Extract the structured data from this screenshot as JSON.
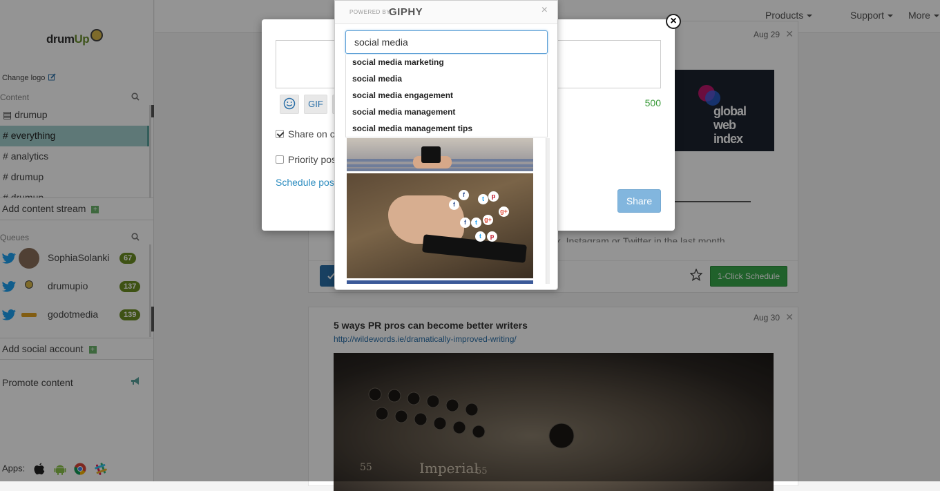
{
  "sidebar": {
    "logo_text": "drumUp",
    "logo_text_a": "drum",
    "logo_text_b": "Up",
    "change_logo": "Change logo",
    "content_header": "Content",
    "streams": [
      {
        "prefix": "▤",
        "label": "drumup"
      },
      {
        "prefix": "#",
        "label": "everything"
      },
      {
        "prefix": "#",
        "label": "analytics"
      },
      {
        "prefix": "#",
        "label": "drumup"
      },
      {
        "prefix": "#",
        "label": "drumup"
      }
    ],
    "add_stream": "Add content stream",
    "queues_header": "Queues",
    "queues": [
      {
        "name": "SophiaSolanki",
        "count": "67"
      },
      {
        "name": "drumupio",
        "count": "137"
      },
      {
        "name": "godotmedia",
        "count": "139"
      }
    ],
    "add_social": "Add social account",
    "promote": "Promote content",
    "apps_label": "Apps:"
  },
  "topnav": {
    "products": "Products",
    "support": "Support",
    "more": "More"
  },
  "feed": {
    "card1": {
      "date": "Aug 29",
      "image_text_1": "global",
      "image_text_2": "web",
      "image_text_3": "index",
      "snippet": "ok, Instagram or Twitter in the last month",
      "one_click": "1-Click Schedule"
    },
    "card2": {
      "date": "Aug 30",
      "title": "5 ways PR pros can become better writers",
      "link": "http://wildewords.ie/dramatically-improved-writing/",
      "image_text": "Imperial",
      "image_num_1": "55",
      "image_num_2": "55"
    }
  },
  "compose": {
    "gif_label": "GIF",
    "char_count": "500",
    "share_on": "Share on co",
    "priority": "Priority pos",
    "schedule": "Schedule pos",
    "share": "Share",
    "close": "×"
  },
  "giphy": {
    "powered_by": "POWERED BY",
    "brand": "GIPHY",
    "close": "×",
    "query": "social media",
    "suggestions": [
      "social media marketing",
      "social media",
      "social media engagement",
      "social media management",
      "social media management tips"
    ]
  },
  "colors": {
    "accent_teal": "#a3cfcd",
    "count_green": "#6b8e23",
    "share_blue": "#82b6de",
    "schedule_green": "#37a84b",
    "link_blue": "#2a6fa8"
  }
}
